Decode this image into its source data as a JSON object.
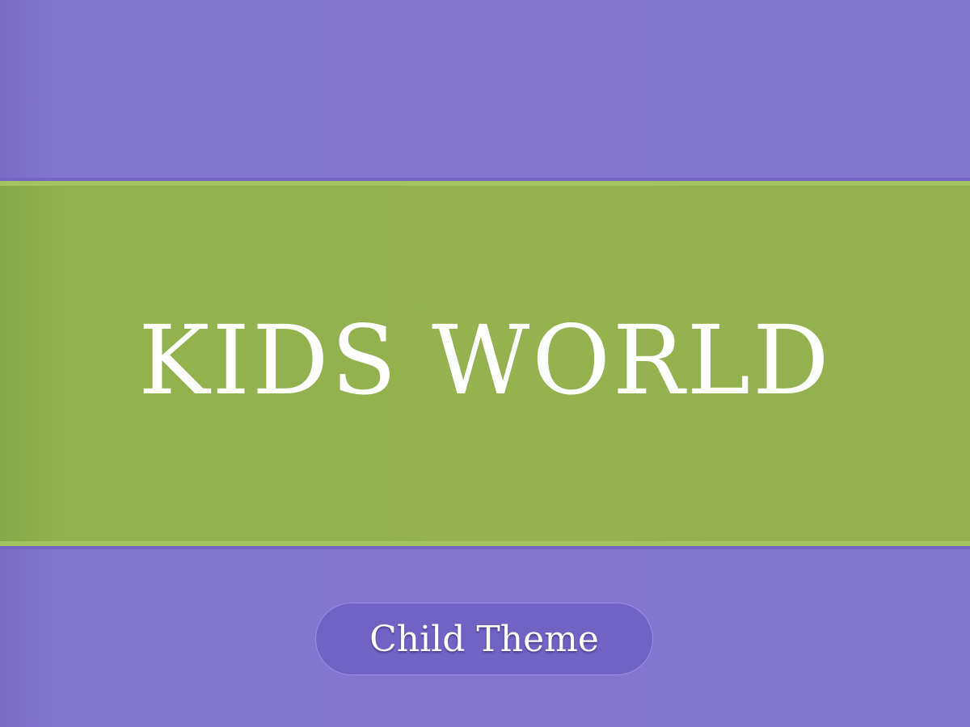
{
  "hero": {
    "title": "KIDS WORLD"
  },
  "badge": {
    "label": "Child Theme"
  },
  "colors": {
    "background_purple": "#8276cf",
    "band_green": "#95b150",
    "text": "#ffffff",
    "badge_purple": "#7163c3"
  }
}
